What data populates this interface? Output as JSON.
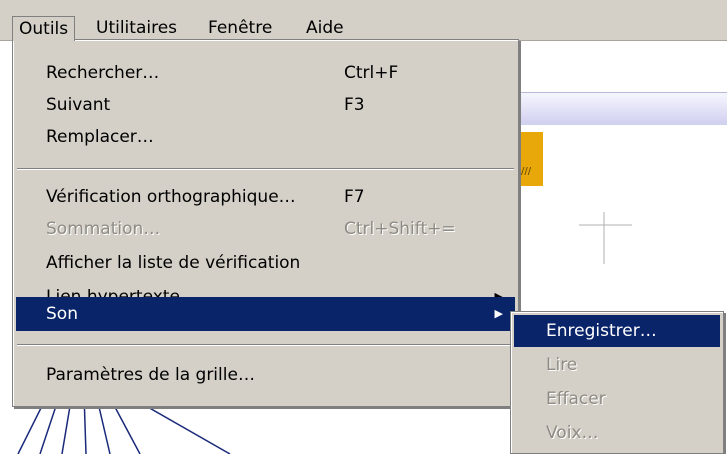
{
  "menubar": {
    "items": [
      {
        "label": "Outils"
      },
      {
        "label": "Utilitaires"
      },
      {
        "label": "Fenêtre"
      },
      {
        "label": "Aide"
      }
    ]
  },
  "outils_menu": {
    "items": [
      {
        "label": "Rechercher…",
        "shortcut": "Ctrl+F"
      },
      {
        "label": "Suivant",
        "shortcut": "F3"
      },
      {
        "label": "Remplacer…",
        "shortcut": ""
      },
      {
        "label": "Vérification orthographique…",
        "shortcut": "F7"
      },
      {
        "label": "Sommation…",
        "shortcut": "Ctrl+Shift+=",
        "disabled": true
      },
      {
        "label": "Afficher la liste de vérification",
        "shortcut": ""
      },
      {
        "label": "Lien hypertexte",
        "shortcut": "",
        "submenu": true
      },
      {
        "label": "Son",
        "shortcut": "",
        "submenu": true,
        "highlighted": true
      },
      {
        "label": "Paramètres de la grille…",
        "shortcut": ""
      }
    ]
  },
  "son_submenu": {
    "items": [
      {
        "label": "Enregistrer…",
        "highlighted": true
      },
      {
        "label": "Lire",
        "disabled": true
      },
      {
        "label": "Effacer",
        "disabled": true
      },
      {
        "label": "Voix…",
        "disabled": true
      }
    ]
  },
  "colors": {
    "menu_bg": "#d4d0c8",
    "highlight": "#0a246a",
    "disabled_text": "#8f8b84",
    "handle": "#e8a80a"
  }
}
